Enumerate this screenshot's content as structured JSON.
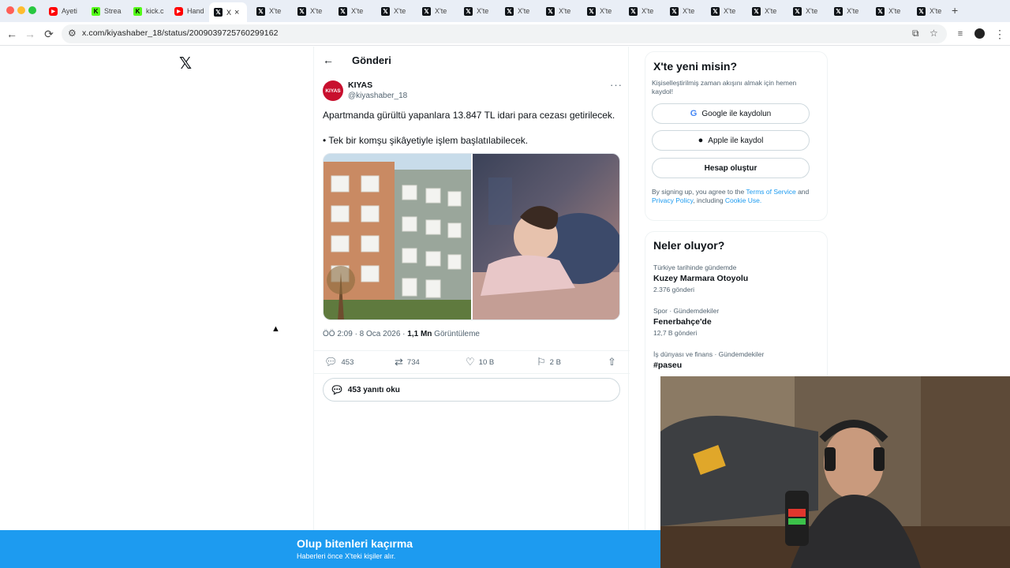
{
  "browser": {
    "tabs": [
      {
        "icon": "youtube",
        "title": "Ayeti"
      },
      {
        "icon": "kick",
        "title": "Strea"
      },
      {
        "icon": "kick",
        "title": "kick.c"
      },
      {
        "icon": "youtube",
        "title": "Hand"
      },
      {
        "icon": "x",
        "title": "X",
        "active": true
      },
      {
        "icon": "x",
        "title": "X'te "
      },
      {
        "icon": "x",
        "title": "X'te "
      },
      {
        "icon": "x",
        "title": "X'te "
      },
      {
        "icon": "x",
        "title": "X'te "
      },
      {
        "icon": "x",
        "title": "X'te "
      },
      {
        "icon": "x",
        "title": "X'te "
      },
      {
        "icon": "x",
        "title": "X'te "
      },
      {
        "icon": "x",
        "title": "X'te "
      },
      {
        "icon": "x",
        "title": "X'te "
      },
      {
        "icon": "x",
        "title": "X'te "
      },
      {
        "icon": "x",
        "title": "X'te "
      },
      {
        "icon": "x",
        "title": "X'te "
      },
      {
        "icon": "x",
        "title": "X'te "
      },
      {
        "icon": "x",
        "title": "X'te "
      },
      {
        "icon": "x",
        "title": "X'te "
      },
      {
        "icon": "x",
        "title": "X'te "
      },
      {
        "icon": "x",
        "title": "X'te "
      }
    ],
    "url": "x.com/kiyashaber_18/status/2009039725760299162"
  },
  "post_page": {
    "header_title": "Gönderi",
    "author": {
      "avatar_text": "KIYAS",
      "name": "KIYAS",
      "handle": "@kiyashaber_18"
    },
    "text_line1": "Apartmanda gürültü yapanlara 13.847 TL idari para cezası getirilecek.",
    "text_line2": "• Tek bir komşu şikâyetiyle işlem başlatılabilecek.",
    "timestamp": "ÖÖ 2:09 · 8 Oca 2026 · ",
    "views_count": "1,1 Mn",
    "views_label": " Görüntüleme",
    "actions": {
      "replies": "453",
      "reposts": "734",
      "likes": "10 B",
      "bookmarks": "2 B"
    },
    "read_replies": "453 yanıtı oku"
  },
  "signup": {
    "title": "X'te yeni misin?",
    "desc": "Kişiselleştirilmiş zaman akışını almak için hemen kaydol!",
    "google": "Google ile kaydolun",
    "apple": "Apple ile kaydol",
    "create": "Hesap oluştur",
    "terms_prefix": "By signing up, you agree to the ",
    "terms_link": "Terms of Service",
    "terms_and": " and ",
    "privacy_link": "Privacy Policy",
    "terms_including": ", including ",
    "cookie_link": "Cookie Use."
  },
  "trends": {
    "title": "Neler oluyor?",
    "items": [
      {
        "meta": "Türkiye tarihinde gündemde",
        "name": "Kuzey Marmara Otoyolu",
        "count": "2.376 gönderi"
      },
      {
        "meta": "Spor · Gündemdekiler",
        "name": "Fenerbahçe'de",
        "count": "12,7 B gönderi"
      },
      {
        "meta": "İş dünyası ve finans · Gündemdekiler",
        "name": "#paseu",
        "count": ""
      }
    ]
  },
  "banner": {
    "title": "Olup bitenleri kaçırma",
    "subtitle": "Haberleri önce X'teki kişiler alır."
  },
  "colors": {
    "accent": "#1d9bf0",
    "avatar": "#c8102e",
    "text": "#0f1419",
    "muted": "#536471"
  }
}
